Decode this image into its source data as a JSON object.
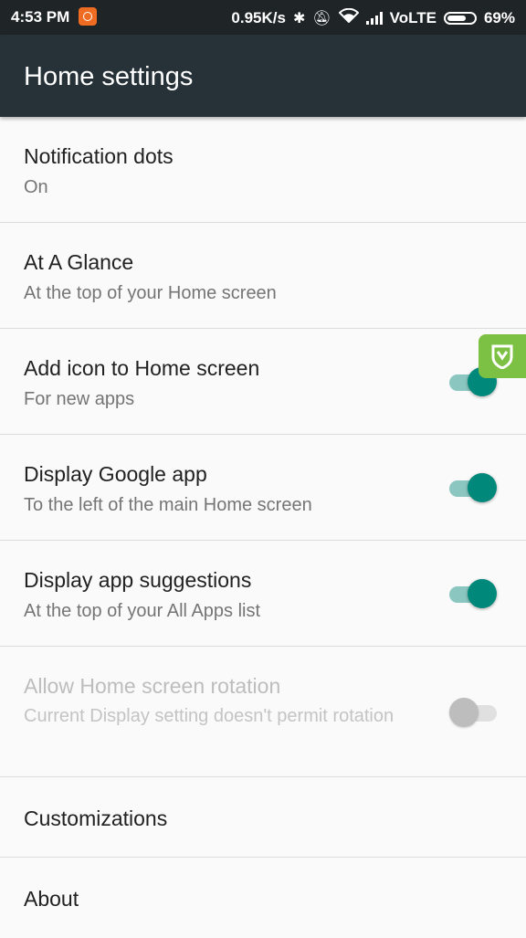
{
  "status_bar": {
    "time": "4:53 PM",
    "speed": "0.95K/s",
    "network": "VoLTE",
    "battery": "69%",
    "icons": [
      "notification-app-icon",
      "bluetooth-icon",
      "mute-icon",
      "wifi-icon",
      "signal-icon",
      "battery-icon"
    ]
  },
  "app_bar": {
    "title": "Home settings",
    "background": "#263238"
  },
  "settings": [
    {
      "title": "Notification dots",
      "summary": "On"
    },
    {
      "title": "At A Glance",
      "summary": "At the top of your Home screen"
    },
    {
      "title": "Add icon to Home screen",
      "summary": "For new apps",
      "toggle": true
    },
    {
      "title": "Display Google app",
      "summary": "To the left of the main Home screen",
      "toggle": true
    },
    {
      "title": "Display app suggestions",
      "summary": "At the top of your All Apps list",
      "toggle": true
    },
    {
      "title": "Allow Home screen rotation",
      "summary": "Current Display setting doesn't permit rotation",
      "toggle": false,
      "disabled": true
    },
    {
      "title": "Customizations"
    },
    {
      "title": "About"
    }
  ],
  "colors": {
    "accent": "#00897b",
    "accent_track": "#8bc7c0",
    "floating_badge": "#7cc143"
  },
  "floating_badge_icon": "shield-icon"
}
